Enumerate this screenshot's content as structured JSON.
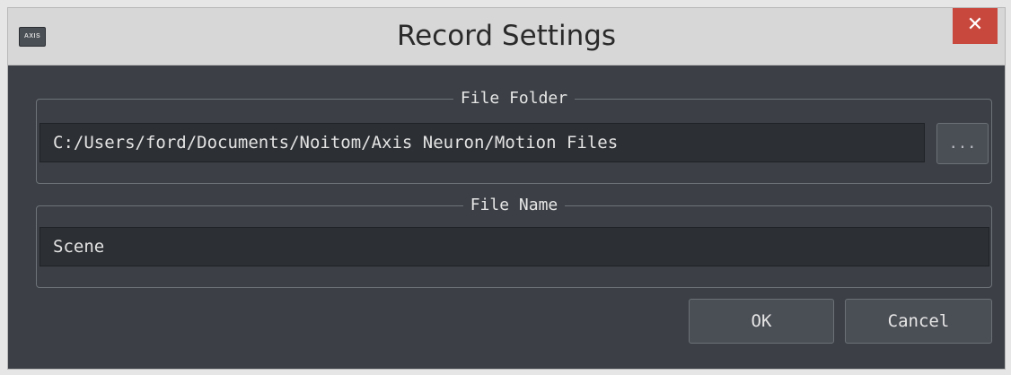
{
  "window": {
    "title": "Record Settings",
    "app_icon_text": "AXIS",
    "close_glyph": "✕"
  },
  "file_folder": {
    "legend": "File Folder",
    "path": "C:/Users/ford/Documents/Noitom/Axis Neuron/Motion Files",
    "browse_label": "..."
  },
  "file_name": {
    "legend": "File Name",
    "value": "Scene"
  },
  "actions": {
    "ok_label": "OK",
    "cancel_label": "Cancel"
  },
  "colors": {
    "close_button": "#c9483e",
    "dialog_background": "#3c4046",
    "field_background": "#2c2f34",
    "titlebar": "#d7d7d7"
  }
}
